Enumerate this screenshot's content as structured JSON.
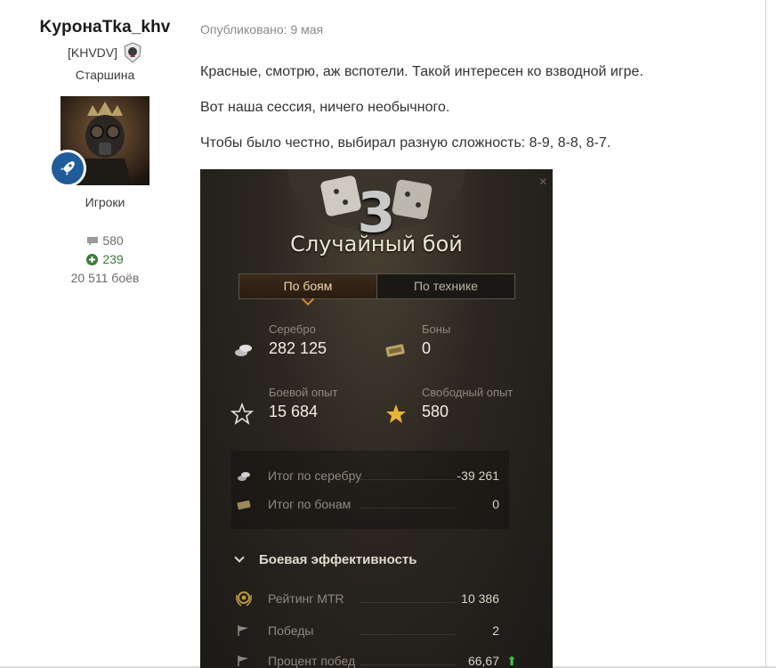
{
  "author": {
    "name": "KypoнaTka_khv",
    "clan": "[KHVDV]",
    "rank": "Старшина",
    "group": "Игроки",
    "posts": "580",
    "reputation": "239",
    "battles": "20 511 боёв"
  },
  "post": {
    "published": "Опубликовано: 9 мая",
    "paragraphs": [
      "Красные, смотрю, аж вспотели. Такой интересен ко взводной игре.",
      "Вот наша сессия, ничего необычного.",
      "Чтобы было честно, выбирал разную сложность: 8-9, 8-8, 8-7."
    ]
  },
  "game": {
    "close": "×",
    "number": "3",
    "title": "Случайный бой",
    "tabs": [
      "По боям",
      "По технике"
    ],
    "silver_label": "Серебро",
    "silver_value": "282 125",
    "bonds_label": "Боны",
    "bonds_value": "0",
    "xp_label": "Боевой опыт",
    "xp_value": "15 684",
    "free_xp_label": "Свободный опыт",
    "free_xp_value": "580",
    "summary": [
      {
        "label": "Итог по серебру",
        "value": "-39 261"
      },
      {
        "label": "Итог по бонам",
        "value": "0"
      }
    ],
    "section": "Боевая эффективность",
    "efficiency": [
      {
        "label": "Рейтинг MTR",
        "value": "10 386"
      },
      {
        "label": "Победы",
        "value": "2"
      },
      {
        "label": "Процент побед",
        "value": "66,67"
      }
    ],
    "up_arrow": "⬆"
  },
  "colors": {
    "badge": "#1f5c99",
    "reputation": "#3b7d3b",
    "accent_orange": "#d9852f",
    "gold_star": "#e8b33a"
  }
}
